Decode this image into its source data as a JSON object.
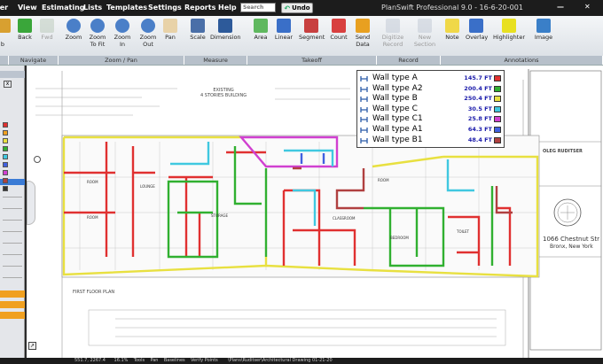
{
  "menu": {
    "items": [
      "her",
      "View",
      "Estimating",
      "Lists",
      "Templates",
      "Settings",
      "Reports",
      "Help"
    ],
    "search_placeholder": "Search",
    "undo_label": "Undo",
    "app_title": "PlanSwift Professional 9.0 - 16-6-20-001"
  },
  "window_buttons": {
    "minimize": "—",
    "close": "✕"
  },
  "ribbon": {
    "buttons": [
      {
        "label": "\nb",
        "icon": "partial-icon",
        "disabled": false
      },
      {
        "label": "Back",
        "icon": "back-arrow-icon",
        "disabled": false
      },
      {
        "label": "Fwd",
        "icon": "forward-arrow-icon",
        "disabled": true
      },
      {
        "label": "Zoom",
        "icon": "zoom-icon",
        "disabled": false
      },
      {
        "label": "Zoom\nTo Fit",
        "icon": "zoom-fit-icon",
        "disabled": false
      },
      {
        "label": "Zoom\nIn",
        "icon": "zoom-in-icon",
        "disabled": false
      },
      {
        "label": "Zoom\nOut",
        "icon": "zoom-out-icon",
        "disabled": false
      },
      {
        "label": "Pan",
        "icon": "hand-icon",
        "disabled": false
      },
      {
        "label": "Scale",
        "icon": "scale-icon",
        "disabled": false
      },
      {
        "label": "Dimension",
        "icon": "dimension-icon",
        "disabled": false
      },
      {
        "label": "Area",
        "icon": "area-icon",
        "disabled": false
      },
      {
        "label": "Linear",
        "icon": "linear-icon",
        "disabled": false
      },
      {
        "label": "Segment",
        "icon": "segment-icon",
        "disabled": false
      },
      {
        "label": "Count",
        "icon": "count-icon",
        "disabled": false
      },
      {
        "label": "Send\nData",
        "icon": "send-data-icon",
        "disabled": false
      },
      {
        "label": "Digitize\nRecord",
        "icon": "digitize-icon",
        "disabled": true
      },
      {
        "label": "New\nSection",
        "icon": "new-section-icon",
        "disabled": true
      },
      {
        "label": "Note",
        "icon": "note-icon",
        "disabled": false
      },
      {
        "label": "Overlay",
        "icon": "overlay-icon",
        "disabled": false
      },
      {
        "label": "Highlighter",
        "icon": "highlighter-icon",
        "disabled": false
      },
      {
        "label": "Image",
        "icon": "image-icon",
        "disabled": false
      }
    ],
    "groups": [
      "",
      "Navigate",
      "Zoom / Pan",
      "Measure",
      "Takeoff",
      "Record",
      "Annotations"
    ]
  },
  "legend": [
    {
      "name": "Wall type A",
      "value": "145.7 FT",
      "color": "#e03030"
    },
    {
      "name": "Wall type A2",
      "value": "200.4 FT",
      "color": "#30b030"
    },
    {
      "name": "Wall type B",
      "value": "250.4 FT",
      "color": "#e8e040"
    },
    {
      "name": "Wall type C",
      "value": "30.5 FT",
      "color": "#40c8e0"
    },
    {
      "name": "Wall type C1",
      "value": "25.8 FT",
      "color": "#d040d0"
    },
    {
      "name": "Wall type A1",
      "value": "64.3 FT",
      "color": "#4060e0"
    },
    {
      "name": "Wall type B1",
      "value": "48.4 FT",
      "color": "#b04040"
    }
  ],
  "plan": {
    "existing_label": "EXISTING\n4 STORIES BUILDING",
    "floor_plan_label": "FIRST FLOOR PLAN",
    "title_block": {
      "architect": "OLEG RUDITSER",
      "address_1": "1066 Chestnut Str",
      "address_2": "Bronx, New York"
    }
  },
  "status": {
    "text": "551.7, 2267.4      16.1%    Tools    Pan    Baselines    Verify Points       \\Plans\\Ruditser\\Architectural Drawing 01-21-20"
  }
}
